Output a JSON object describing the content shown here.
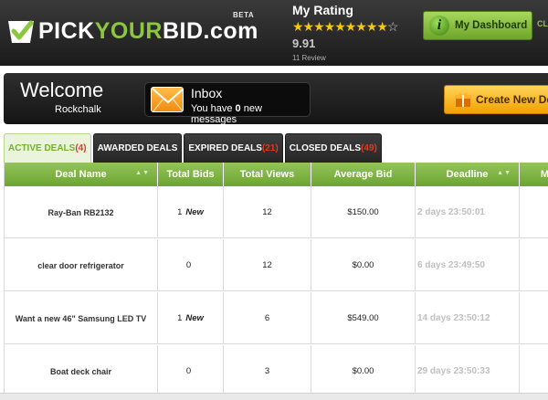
{
  "header": {
    "logo_part1": "PICK",
    "logo_part2": "YOUR",
    "logo_part3": "BID",
    "logo_part4": ".com",
    "beta": "BETA",
    "rating_title": "My Rating",
    "stars_filled": "★★★★★★★★★",
    "stars_empty": "☆",
    "rating_score": "9.91",
    "rating_reviews": "11 Review",
    "dashboard_label": "My Dashboard",
    "dashboard_icon_letter": "i",
    "cut_link": "CL"
  },
  "welcome": {
    "title": "Welcome",
    "username": "Rockchalk",
    "inbox_title": "Inbox",
    "inbox_msg_prefix": "You have ",
    "inbox_count": "0",
    "inbox_msg_suffix": " new messages",
    "create_label": "Create New De"
  },
  "tabs": [
    {
      "label": "ACTIVE DEALS",
      "count": "(4)"
    },
    {
      "label": "AWARDED DEALS",
      "count": ""
    },
    {
      "label": "EXPIRED DEALS",
      "count": "(21)"
    },
    {
      "label": "CLOSED DEALS",
      "count": "(49)"
    }
  ],
  "table": {
    "columns": [
      "Deal Name",
      "Total Bids",
      "Total Views",
      "Average Bid",
      "Deadline",
      "M"
    ],
    "sort_glyph": "▲▼",
    "rows": [
      {
        "name": "Ray-Ban RB2132",
        "bids": "1",
        "new": "New",
        "views": "12",
        "avg": "$150.00",
        "deadline": "2 days 23:50:01"
      },
      {
        "name": "clear door refrigerator",
        "bids": "0",
        "new": "",
        "views": "12",
        "avg": "$0.00",
        "deadline": "6 days 23:49:50"
      },
      {
        "name": "Want a new 46\" Samsung LED TV",
        "bids": "1",
        "new": "New",
        "views": "6",
        "avg": "$549.00",
        "deadline": "14 days 23:50:12"
      },
      {
        "name": "Boat deck chair",
        "bids": "0",
        "new": "",
        "views": "3",
        "avg": "$0.00",
        "deadline": "29 days 23:50:33"
      }
    ]
  },
  "colors": {
    "brand_green": "#8dc63f",
    "header_dark": "#1b1b1b",
    "accent_orange": "#f2a100",
    "count_red": "#e03a1e"
  }
}
